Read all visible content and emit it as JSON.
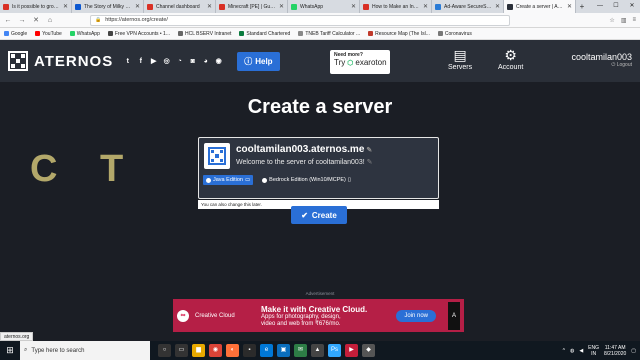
{
  "browser": {
    "tabs": [
      {
        "label": "Is it possible to grow...",
        "color": "#d93025"
      },
      {
        "label": "The Story of Milky M...",
        "color": "#0b57d0"
      },
      {
        "label": "Channel dashboard",
        "color": "#d93025"
      },
      {
        "label": "Minecraft [PE] | Guid...",
        "color": "#d93025"
      },
      {
        "label": "WhatsApp",
        "color": "#25d366"
      },
      {
        "label": "How to Make an Infin...",
        "color": "#d93025"
      },
      {
        "label": "Ad-Aware SecureSear...",
        "color": "#2a7bd6"
      },
      {
        "label": "Create a server | Ater...",
        "color": "#2a2f38"
      }
    ],
    "url": "https://aternos.org/create/",
    "bookmarks": [
      {
        "label": "Google",
        "color": "#4285f4"
      },
      {
        "label": "YouTube",
        "color": "#ff0000"
      },
      {
        "label": "WhatsApp",
        "color": "#25d366"
      },
      {
        "label": "Free VPN Accounts • 1...",
        "color": "#444444"
      },
      {
        "label": "HCL BSERV Intranet",
        "color": "#666666"
      },
      {
        "label": "Standard Chartered",
        "color": "#0a7b3e"
      },
      {
        "label": "TNEB Tariff Calculator ...",
        "color": "#888888"
      },
      {
        "label": "Resource Map (The Isl...",
        "color": "#c0392b"
      },
      {
        "label": "Coronavirus",
        "color": "#777777"
      }
    ]
  },
  "site": {
    "logo": "ATERNOS",
    "social_icons": [
      "twitter-icon",
      "facebook-icon",
      "youtube-icon",
      "instagram-icon",
      "reddit-icon",
      "discord-icon",
      "teamspeak-icon",
      "github-icon"
    ],
    "help_label": "Help",
    "exaroton_line1": "Need more?",
    "exaroton_try": "Try",
    "exaroton_brand": "exaroton",
    "servers_label": "Servers",
    "account_label": "Account",
    "username": "cooltamilan003",
    "logout_label": "Logout"
  },
  "main": {
    "background_text": "C T",
    "title": "Create a server",
    "server_address": "cooltamilan003.aternos.me",
    "motd": "Welcome to the server of cooltamilan003!",
    "editions": [
      {
        "label": "Java Edition",
        "selected": true
      },
      {
        "label": "Bedrock Edition (Win10/MCPE)",
        "selected": false
      }
    ],
    "change_note": "You can also change this later.",
    "create_label": "Create",
    "ad_label": "Advertisement",
    "ad": {
      "brand": "Creative Cloud",
      "headline": "Make it with Creative Cloud.",
      "sub1": "Apps for photography, design,",
      "sub2": "video and web from ₹676/mo.",
      "cta": "Join now",
      "adobe": "Adobe"
    }
  },
  "status_url": "aternos.org",
  "taskbar": {
    "search_placeholder": "Type here to search",
    "lang": "ENG",
    "region": "IN",
    "time": "11:47 AM",
    "date": "8/21/2020"
  }
}
